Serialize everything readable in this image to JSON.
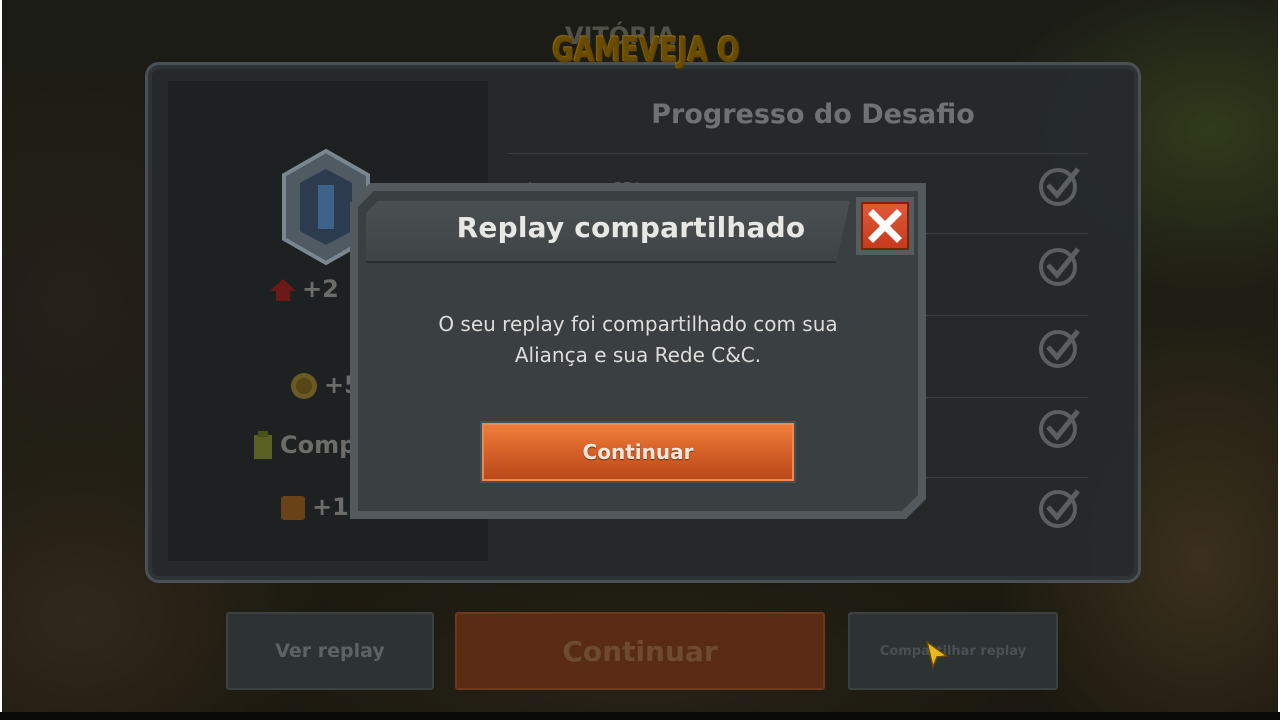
{
  "watermark": "GAMEVEJA O",
  "background_title": "VITÓRIA",
  "results": {
    "challenge_title": "Progresso do Desafio",
    "challenge_first_item": "Jogue com GDI",
    "rewards": {
      "rank_points": "+2",
      "credits": "+5",
      "component": "Comp",
      "xp": "+100"
    }
  },
  "bottom_buttons": {
    "replay_label": "Ver replay",
    "continue_label": "Continuar",
    "share_label": "Compartilhar replay"
  },
  "modal": {
    "title": "Replay compartilhado",
    "message_line1": "O seu replay foi compartilhado com sua",
    "message_line2": "Aliança e sua Rede C&C.",
    "continue_label": "Continuar"
  },
  "colors": {
    "accent_orange": "#d9632a",
    "close_red": "#c63a1d",
    "panel_gray": "#3a3f41",
    "watermark_gold": "#f0c030"
  }
}
